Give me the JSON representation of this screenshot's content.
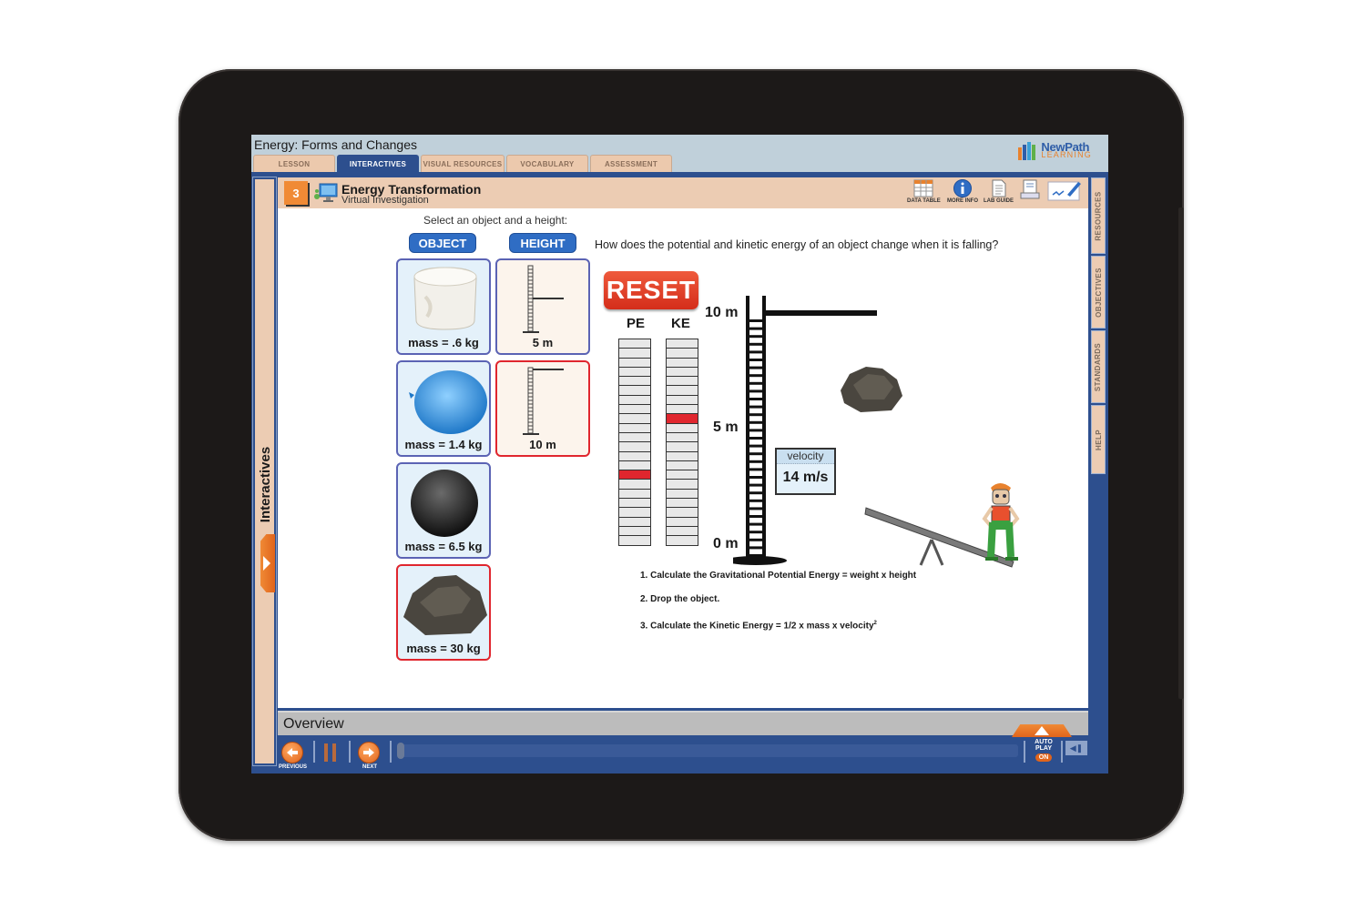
{
  "app": {
    "title": "Energy: Forms and Changes",
    "logo": {
      "line1": "NewPath",
      "line2": "LEARNING"
    }
  },
  "tabs": [
    {
      "label": "LESSON",
      "active": false
    },
    {
      "label": "INTERACTIVES",
      "active": true
    },
    {
      "label": "VISUAL RESOURCES",
      "active": false
    },
    {
      "label": "VOCABULARY",
      "active": false
    },
    {
      "label": "ASSESSMENT",
      "active": false
    }
  ],
  "left_rail": {
    "label": "Interactives"
  },
  "right_rail": [
    {
      "label": "RESOURCES"
    },
    {
      "label": "OBJECTIVES"
    },
    {
      "label": "STANDARDS"
    },
    {
      "label": "HELP"
    }
  ],
  "activity": {
    "number": "3",
    "title": "Energy Transformation",
    "subtitle": "Virtual Investigation",
    "icon": "computer-monitor-icon"
  },
  "toolbar": [
    {
      "label": "DATA TABLE",
      "icon": "data-table-icon"
    },
    {
      "label": "MORE INFO",
      "icon": "info-icon"
    },
    {
      "label": "LAB GUIDE",
      "icon": "document-icon"
    },
    {
      "label": "",
      "icon": "print-icon"
    },
    {
      "label": "",
      "icon": "whiteboard-pen-icon"
    }
  ],
  "selector": {
    "prompt": "Select an object and a height:",
    "object_label": "OBJECT",
    "height_label": "HEIGHT",
    "objects": [
      {
        "name": "marshmallow",
        "caption": "mass = .6 kg",
        "selected": false
      },
      {
        "name": "balloon",
        "caption": "mass = 1.4 kg",
        "selected": false
      },
      {
        "name": "bowling-ball",
        "caption": "mass = 6.5 kg",
        "selected": false
      },
      {
        "name": "rock",
        "caption": "mass = 30 kg",
        "selected": true
      }
    ],
    "heights": [
      {
        "caption": "5 m",
        "selected": false
      },
      {
        "caption": "10 m",
        "selected": true
      }
    ]
  },
  "question": "How does the potential and kinetic energy of an object change when it is falling?",
  "reset_label": "RESET",
  "meters": {
    "segments": 22,
    "pe": {
      "label": "PE",
      "active_segment_from_bottom": 8
    },
    "ke": {
      "label": "KE",
      "active_segment_from_bottom": 14
    }
  },
  "ladder": {
    "top": "10 m",
    "mid": "5 m",
    "bottom": "0 m"
  },
  "velocity": {
    "label": "velocity",
    "value": "14 m/s"
  },
  "steps": [
    "1. Calculate the Gravitational Potential Energy = weight x height",
    "2. Drop the object.",
    "3. Calculate the Kinetic Energy = 1/2 x mass x velocity"
  ],
  "steps_superscript": "2",
  "bottom": {
    "overview_label": "Overview",
    "previous_label": "PREVIOUS",
    "next_label": "NEXT",
    "autoplay_label_1": "AUTO",
    "autoplay_label_2": "PLAY",
    "autoplay_state": "ON",
    "progress": 0
  },
  "colors": {
    "frame_blue": "#2d4f8e",
    "tab_tan": "#ecc9ad",
    "accent_orange": "#f08a35",
    "select_red": "#e0262e",
    "pill_blue": "#2f6dc4"
  }
}
